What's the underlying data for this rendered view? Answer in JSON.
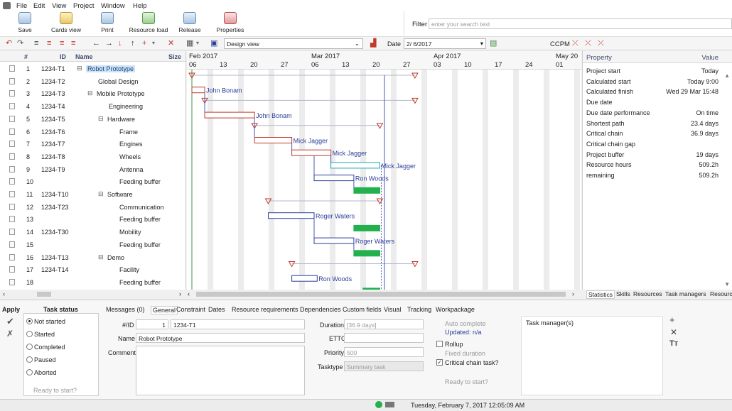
{
  "menu": [
    "File",
    "Edit",
    "View",
    "Project",
    "Window",
    "Help"
  ],
  "ribbon": {
    "buttons": [
      "Save",
      "Cards view",
      "Print",
      "Resource load",
      "Release",
      "Properties"
    ],
    "filter_label": "Filter",
    "filter_placeholder": "enter your search text"
  },
  "toolbar": {
    "view_select": "Design view",
    "date_label": "Date",
    "date_value": "2/ 6/2017",
    "ccpm_label": "CCPM"
  },
  "grid": {
    "headers": {
      "num": "#",
      "id": "ID",
      "name": "Name",
      "size": "Size"
    },
    "rows": [
      {
        "num": "1",
        "id": "1234-T1",
        "name": "Robot Prototype",
        "indent": 0,
        "group": true
      },
      {
        "num": "2",
        "id": "1234-T2",
        "name": "Global Design",
        "indent": 1,
        "group": false
      },
      {
        "num": "3",
        "id": "1234-T3",
        "name": "Mobile Prototype",
        "indent": 1,
        "group": true
      },
      {
        "num": "4",
        "id": "1234-T4",
        "name": "Engineering",
        "indent": 2,
        "group": false
      },
      {
        "num": "5",
        "id": "1234-T5",
        "name": "Hardware",
        "indent": 2,
        "group": true
      },
      {
        "num": "6",
        "id": "1234-T6",
        "name": "Frame",
        "indent": 3,
        "group": false
      },
      {
        "num": "7",
        "id": "1234-T7",
        "name": "Engines",
        "indent": 3,
        "group": false
      },
      {
        "num": "8",
        "id": "1234-T8",
        "name": "Wheels",
        "indent": 3,
        "group": false
      },
      {
        "num": "9",
        "id": "1234-T9",
        "name": "Antenna",
        "indent": 3,
        "group": false
      },
      {
        "num": "10",
        "id": "",
        "name": "Feeding buffer",
        "indent": 3,
        "group": false
      },
      {
        "num": "11",
        "id": "1234-T10",
        "name": "Software",
        "indent": 2,
        "group": true
      },
      {
        "num": "12",
        "id": "1234-T23",
        "name": "Communication",
        "indent": 3,
        "group": false
      },
      {
        "num": "13",
        "id": "",
        "name": "Feeding buffer",
        "indent": 3,
        "group": false
      },
      {
        "num": "14",
        "id": "1234-T30",
        "name": "Mobility",
        "indent": 3,
        "group": false
      },
      {
        "num": "15",
        "id": "",
        "name": "Feeding buffer",
        "indent": 3,
        "group": false
      },
      {
        "num": "16",
        "id": "1234-T13",
        "name": "Demo",
        "indent": 2,
        "group": true
      },
      {
        "num": "17",
        "id": "1234-T14",
        "name": "Facility",
        "indent": 3,
        "group": false
      },
      {
        "num": "18",
        "id": "",
        "name": "Feeding buffer",
        "indent": 3,
        "group": false
      }
    ]
  },
  "gantt": {
    "months": [
      {
        "label": "Feb 2017",
        "col": 0
      },
      {
        "label": "Mar 2017",
        "col": 4
      },
      {
        "label": "Apr 2017",
        "col": 8
      },
      {
        "label": "May 20",
        "col": 12
      }
    ],
    "days": [
      "06",
      "13",
      "20",
      "27",
      "06",
      "13",
      "20",
      "27",
      "03",
      "10",
      "17",
      "24",
      "01"
    ],
    "bars": [
      {
        "row": 1,
        "start": 0,
        "end": 0.42,
        "kind": "task",
        "resource": "John Bonam"
      },
      {
        "row": 3,
        "start": 0.42,
        "end": 2.05,
        "kind": "task",
        "resource": "John Bonam"
      },
      {
        "row": 5,
        "start": 2.05,
        "end": 3.27,
        "kind": "task",
        "resource": "Mick Jagger"
      },
      {
        "row": 6,
        "start": 3.27,
        "end": 4.55,
        "kind": "task",
        "resource": "Mick Jagger"
      },
      {
        "row": 7,
        "start": 4.55,
        "end": 6.15,
        "kind": "critical",
        "resource": "Mick Jagger"
      },
      {
        "row": 8,
        "start": 4.0,
        "end": 5.3,
        "kind": "chain",
        "resource": "Ron Woods"
      },
      {
        "row": 9,
        "start": 5.3,
        "end": 6.15,
        "kind": "buffer",
        "resource": ""
      },
      {
        "row": 11,
        "start": 2.5,
        "end": 4.0,
        "kind": "chain",
        "resource": "Roger Waters"
      },
      {
        "row": 12,
        "start": 5.3,
        "end": 6.15,
        "kind": "buffer",
        "resource": ""
      },
      {
        "row": 13,
        "start": 4.0,
        "end": 5.3,
        "kind": "chain",
        "resource": "Roger Waters"
      },
      {
        "row": 14,
        "start": 5.3,
        "end": 6.15,
        "kind": "buffer",
        "resource": ""
      },
      {
        "row": 16,
        "start": 3.27,
        "end": 4.1,
        "kind": "chain",
        "resource": "Ron Woods"
      },
      {
        "row": 17,
        "start": 5.6,
        "end": 6.15,
        "kind": "buffer",
        "resource": ""
      }
    ],
    "summaries": [
      {
        "row": 0,
        "start": 0,
        "end": 7.3
      },
      {
        "row": 2,
        "start": 0.42,
        "end": 7.3
      },
      {
        "row": 4,
        "start": 2.05,
        "end": 6.15
      },
      {
        "row": 10,
        "start": 2.5,
        "end": 6.15
      },
      {
        "row": 15,
        "start": 3.27,
        "end": 7.3
      }
    ]
  },
  "properties": {
    "header": {
      "key": "Property",
      "value": "Value"
    },
    "items": [
      {
        "k": "Project start",
        "v": "Today"
      },
      {
        "k": "Calculated start",
        "v": "Today 9:00"
      },
      {
        "k": "Calculated finish",
        "v": "Wed 29 Mar 15:48"
      },
      {
        "k": "Due date",
        "v": ""
      },
      {
        "k": "Due date performance",
        "v": "On time"
      },
      {
        "k": "Shortest path",
        "v": "23.4 days"
      },
      {
        "k": "Critical chain",
        "v": "36.9 days"
      },
      {
        "k": "Critical chain gap",
        "v": ""
      },
      {
        "k": "Project buffer",
        "v": "19 days"
      },
      {
        "k": "Resource hours",
        "v": "509.2h"
      },
      {
        "k": " remaining",
        "v": "509.2h"
      }
    ],
    "tabs": [
      "Statistics",
      "Skills",
      "Resources",
      "Task managers",
      "Resourc"
    ]
  },
  "details": {
    "apply_label": "Apply",
    "task_status_title": "Task status",
    "statuses": [
      "Not started",
      "Started",
      "Completed",
      "Paused",
      "Aborted"
    ],
    "selected_status": "Not started",
    "ready_to_start": "Ready to start?",
    "tabs": [
      "Messages (0)",
      "General",
      "Constraint",
      "Dates",
      "Resource requirements",
      "Dependencies",
      "Custom fields",
      "Visual",
      "Tracking",
      "Workpackage"
    ],
    "active_tab": "General",
    "id_label": "#/ID",
    "num_value": "1",
    "id_value": "1234-T1",
    "name_label": "Name",
    "name_value": "Robot Prototype",
    "comment_label": "Comment",
    "duration_label": "Duration",
    "duration_value": "[36.9 days]",
    "ettc_label": "ETTC",
    "priority_label": "Priority",
    "priority_value": "500",
    "tasktype_label": "Tasktype",
    "tasktype_value": "Summary task",
    "auto_complete": "Auto complete",
    "updated": "Updated: n/a",
    "rollup": "Rollup",
    "fixed_duration": "Fixed duration",
    "critical_chain_task": "Critical chain task?",
    "ready_to_start2": "Ready to start?",
    "task_managers_label": "Task manager(s)"
  },
  "status_bar": {
    "datetime": "Tuesday, February 7, 2017 12:05:09 AM"
  },
  "colors": {
    "critical": "#c0392b",
    "chain": "#2c3e9a",
    "buffer": "#22b14c",
    "selection": "#cfe3f8"
  }
}
